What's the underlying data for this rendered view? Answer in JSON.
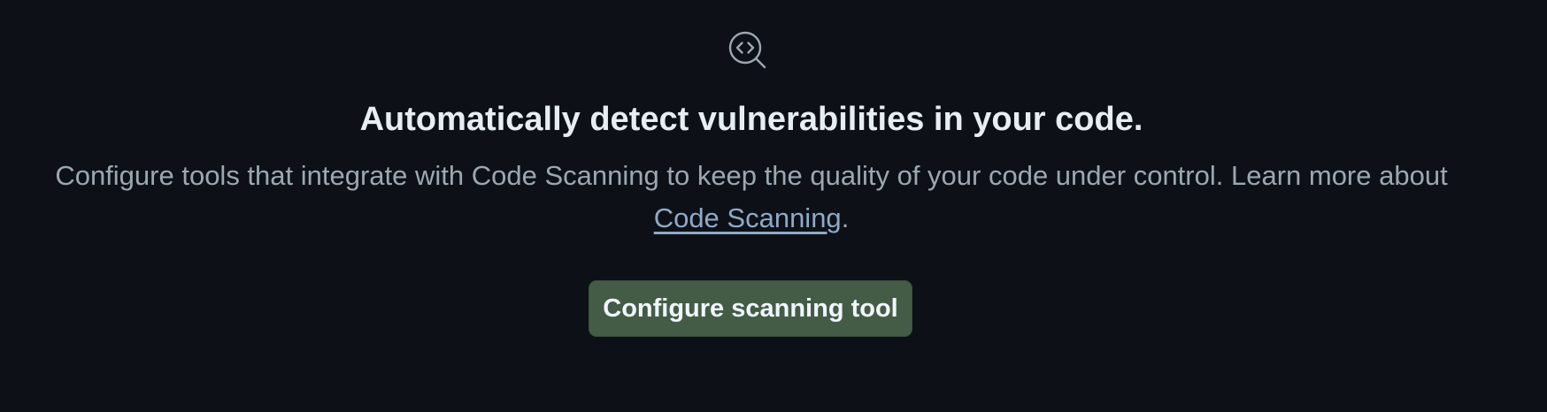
{
  "icon": "code-scan-icon",
  "heading": "Automatically detect vulnerabilities in your code.",
  "description": {
    "text": "Configure tools that integrate with Code Scanning to keep the quality of your code under control. Learn more about",
    "link_text": "Code Scanning",
    "after_link": "."
  },
  "primary_button": "Configure scanning tool",
  "colors": {
    "background": "#0d1117",
    "heading": "#e6edf3",
    "description": "#9da7b1",
    "link": "#8fa9c7",
    "button_bg": "#445c46",
    "button_text": "#f0f6fc",
    "icon": "#9da7b1"
  }
}
